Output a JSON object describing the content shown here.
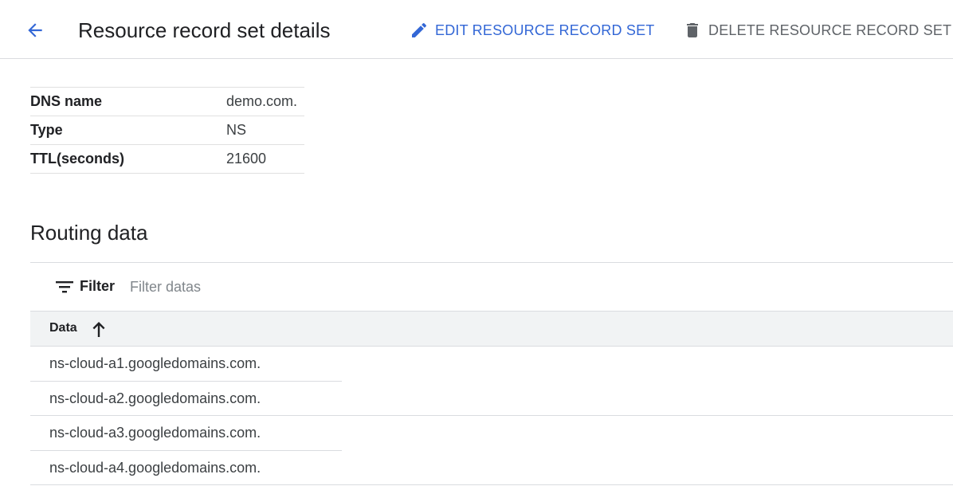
{
  "header": {
    "title": "Resource record set details",
    "edit_label": "EDIT RESOURCE RECORD SET",
    "delete_label": "DELETE RESOURCE RECORD SET"
  },
  "details": [
    {
      "key": "DNS name",
      "value": "demo.com."
    },
    {
      "key": "Type",
      "value": "NS"
    },
    {
      "key": "TTL(seconds)",
      "value": "21600"
    }
  ],
  "routing": {
    "title": "Routing data",
    "filter_label": "Filter",
    "filter_placeholder": "Filter datas",
    "column_header": "Data",
    "rows": [
      "ns-cloud-a1.googledomains.com.",
      "ns-cloud-a2.googledomains.com.",
      "ns-cloud-a3.googledomains.com.",
      "ns-cloud-a4.googledomains.com."
    ]
  },
  "colors": {
    "primary": "#3367d6",
    "text": "#202124",
    "muted": "#5f6368",
    "divider": "#dadce0"
  },
  "icons": [
    "arrow-back-icon",
    "pencil-icon",
    "trash-icon",
    "filter-icon",
    "arrow-up-icon"
  ]
}
